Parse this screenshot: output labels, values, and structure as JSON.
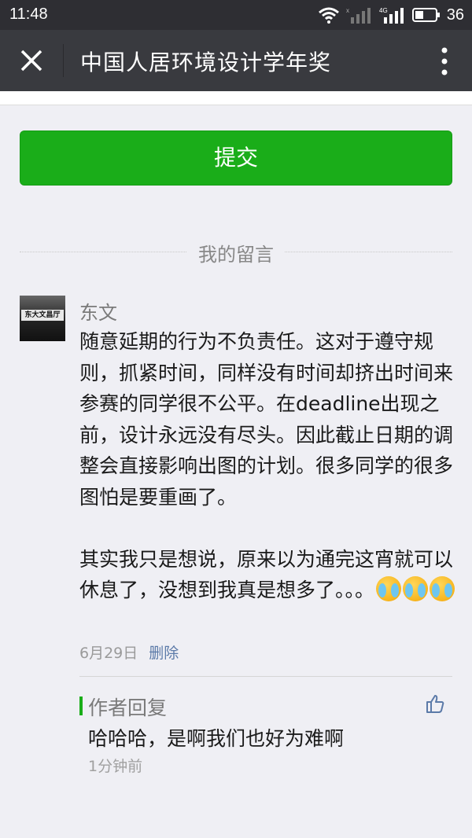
{
  "status_bar": {
    "time": "11:48",
    "battery_level": "36"
  },
  "header": {
    "title": "中国人居环境设计学年奖"
  },
  "form": {
    "submit_label": "提交"
  },
  "comments_section": {
    "heading": "我的留言",
    "comment": {
      "author": "东文",
      "avatar_sign_text": "东大文昌厅",
      "text": "随意延期的行为不负责任。这对于遵守规则，抓紧时间，同样没有时间却挤出时间来参赛的同学很不公平。在deadline出现之前，设计永远没有尽头。因此截止日期的调整会直接影响出图的计划。很多同学的很多图怕是要重画了。\n\n其实我只是想说，原来以为通完这宵就可以休息了，没想到我真是想多了。。。",
      "emoji_names": [
        "facepalm-cry-emoji",
        "facepalm-cry-emoji",
        "facepalm-cry-emoji"
      ],
      "date": "6月29日",
      "delete_label": "删除"
    },
    "reply": {
      "label": "作者回复",
      "text": "哈哈哈，是啊我们也好为难啊",
      "time": "1分钟前"
    }
  },
  "colors": {
    "accent_green": "#1aad19",
    "title_bar": "#393a3f",
    "status_bar": "#2e2e33",
    "link_blue": "#5b7aa8"
  }
}
